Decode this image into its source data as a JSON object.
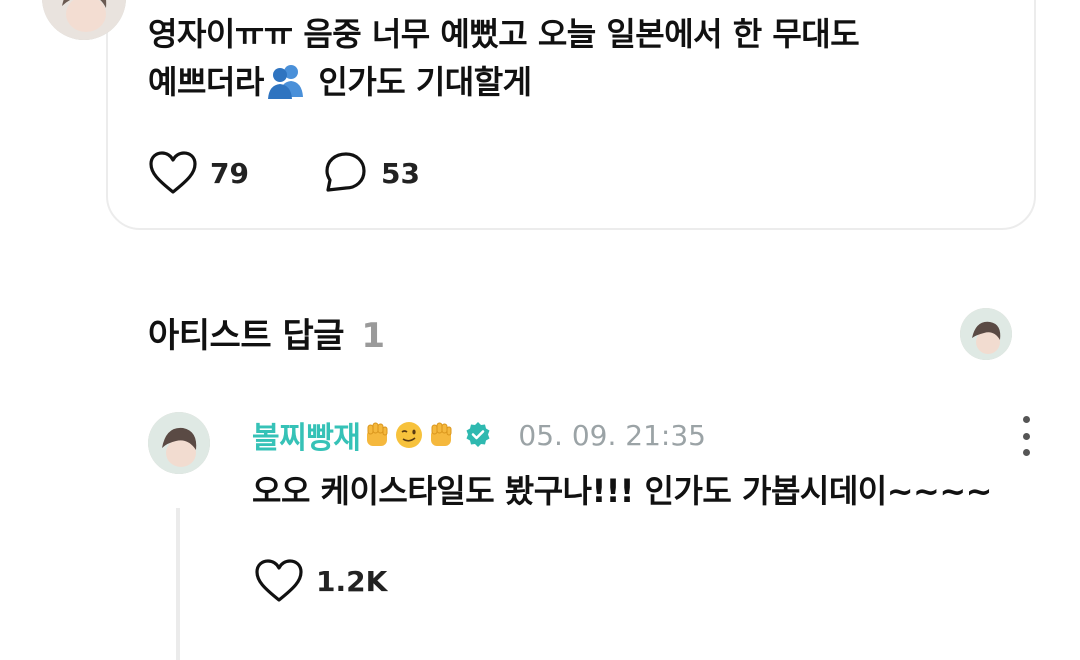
{
  "post": {
    "text_line1": "영자이ㅠㅠ 음중 너무 예뻤고 오늘 일본에서 한 무대도",
    "text_line2_a": "예쁘더라",
    "text_line2_b": " 인가도 기대할게",
    "emoji_icon": "two-people-emoji",
    "like_count": "79",
    "comment_count": "53"
  },
  "artist_replies": {
    "title": "아티스트 답글",
    "count": "1"
  },
  "reply": {
    "author": "볼찌빵재",
    "author_emojis": [
      "raised-fist-emoji",
      "winking-face-emoji",
      "raised-fist-emoji"
    ],
    "verified_icon": "verified-badge-icon",
    "date": "05. 09. 21:35",
    "text": "오오 케이스타일도 봤구나!!! 인가도 가봅시데이~~~~",
    "like_count": "1.2K"
  },
  "colors": {
    "author_name": "#36c2b7",
    "verified_badge": "#2fb9b0",
    "muted_text": "#9ba3a6",
    "card_border": "#ececec"
  }
}
